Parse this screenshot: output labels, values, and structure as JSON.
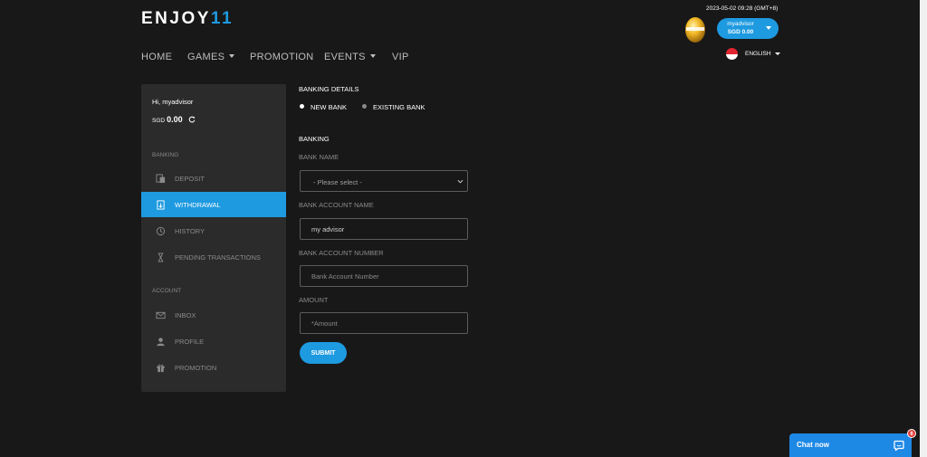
{
  "header": {
    "logo_text": "ENJOY",
    "logo_accent": "11",
    "datetime": "2023-05-02 09:28 (GMT+8)",
    "user": {
      "username": "myadvisor",
      "balance": "SGD 0.00"
    },
    "language": "ENGLISH"
  },
  "nav": {
    "items": [
      {
        "label": "HOME"
      },
      {
        "label": "GAMES"
      },
      {
        "label": "PROMOTION"
      },
      {
        "label": "EVENTS"
      },
      {
        "label": "VIP"
      }
    ]
  },
  "sidebar": {
    "greeting": "Hi, myadvisor",
    "currency": "SGD",
    "balance": "0.00",
    "banking_section": "BANKING",
    "account_section": "ACCOUNT",
    "items": [
      {
        "label": "DEPOSIT",
        "icon": "deposit-icon"
      },
      {
        "label": "WITHDRAWAL",
        "icon": "withdrawal-icon",
        "active": true
      },
      {
        "label": "HISTORY",
        "icon": "history-icon"
      },
      {
        "label": "PENDING TRANSACTIONS",
        "icon": "hourglass-icon"
      },
      {
        "label": "INBOX",
        "icon": "mail-icon"
      },
      {
        "label": "PROFILE",
        "icon": "user-icon"
      },
      {
        "label": "PROMOTION",
        "icon": "gift-icon"
      }
    ]
  },
  "form": {
    "title": "BANKING DETAILS",
    "options": [
      {
        "label": "NEW BANK",
        "selected": true
      },
      {
        "label": "EXISTING BANK",
        "selected": false
      }
    ],
    "section": "BANKING",
    "bank_name_label": "BANK NAME",
    "bank_name_value": "- Please select -",
    "account_name_label": "BANK ACCOUNT NAME",
    "account_name_value": "my advisor",
    "account_number_label": "BANK ACCOUNT NUMBER",
    "account_number_placeholder": "Bank Account Number",
    "amount_label": "AMOUNT",
    "amount_placeholder": "*Amount",
    "submit_label": "SUBMIT"
  },
  "chat": {
    "label": "Chat now",
    "badge": "6"
  },
  "colors": {
    "accent": "#1e9ae0",
    "background": "#181818",
    "panel": "#2b2b2b",
    "chat": "#1e88e5",
    "badge": "#e53935"
  }
}
